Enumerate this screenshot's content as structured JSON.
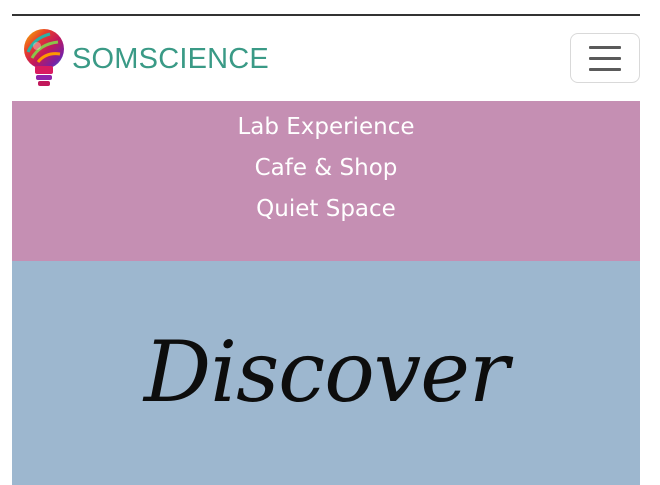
{
  "navbar": {
    "brand_name": "SOMSCIENCE",
    "brand_color": "#3a9a86",
    "logo_icon": "lightbulb-logo-icon",
    "toggle_icon": "hamburger-menu-icon"
  },
  "menu": {
    "background": "#c58fb3",
    "items": [
      {
        "label": "Lab Experience"
      },
      {
        "label": "Cafe & Shop"
      },
      {
        "label": "Quiet Space"
      }
    ]
  },
  "hero": {
    "background": "#9db7cf",
    "title": "Discover"
  }
}
